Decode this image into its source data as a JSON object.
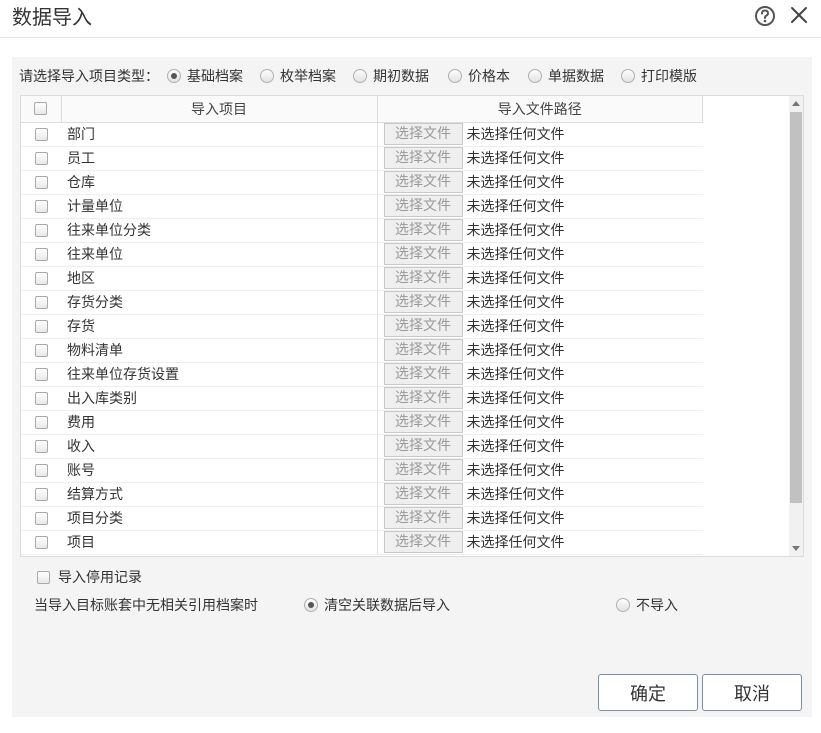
{
  "dialog": {
    "title": "数据导入"
  },
  "import_type": {
    "label": "请选择导入项目类型：",
    "options": [
      {
        "label": "基础档案",
        "checked": true
      },
      {
        "label": "枚举档案",
        "checked": false
      },
      {
        "label": "期初数据",
        "checked": false
      },
      {
        "label": "价格本",
        "checked": false
      },
      {
        "label": "单据数据",
        "checked": false
      },
      {
        "label": "打印模版",
        "checked": false
      }
    ]
  },
  "grid": {
    "headers": {
      "item": "导入项目",
      "path": "导入文件路径"
    },
    "rows": [
      {
        "name": "部门",
        "button": "选择文件",
        "status": "未选择任何文件"
      },
      {
        "name": "员工",
        "button": "选择文件",
        "status": "未选择任何文件"
      },
      {
        "name": "仓库",
        "button": "选择文件",
        "status": "未选择任何文件"
      },
      {
        "name": "计量单位",
        "button": "选择文件",
        "status": "未选择任何文件"
      },
      {
        "name": "往来单位分类",
        "button": "选择文件",
        "status": "未选择任何文件"
      },
      {
        "name": "往来单位",
        "button": "选择文件",
        "status": "未选择任何文件"
      },
      {
        "name": "地区",
        "button": "选择文件",
        "status": "未选择任何文件"
      },
      {
        "name": "存货分类",
        "button": "选择文件",
        "status": "未选择任何文件"
      },
      {
        "name": "存货",
        "button": "选择文件",
        "status": "未选择任何文件"
      },
      {
        "name": "物料清单",
        "button": "选择文件",
        "status": "未选择任何文件"
      },
      {
        "name": "往来单位存货设置",
        "button": "选择文件",
        "status": "未选择任何文件"
      },
      {
        "name": "出入库类别",
        "button": "选择文件",
        "status": "未选择任何文件"
      },
      {
        "name": "费用",
        "button": "选择文件",
        "status": "未选择任何文件"
      },
      {
        "name": "收入",
        "button": "选择文件",
        "status": "未选择任何文件"
      },
      {
        "name": "账号",
        "button": "选择文件",
        "status": "未选择任何文件"
      },
      {
        "name": "结算方式",
        "button": "选择文件",
        "status": "未选择任何文件"
      },
      {
        "name": "项目分类",
        "button": "选择文件",
        "status": "未选择任何文件"
      },
      {
        "name": "项目",
        "button": "选择文件",
        "status": "未选择任何文件"
      }
    ]
  },
  "options": {
    "import_disabled": "导入停用记录",
    "ref_label": "当导入目标账套中无相关引用档案时",
    "ref_clear": "清空关联数据后导入",
    "ref_skip": "不导入",
    "ref_clear_checked": true
  },
  "buttons": {
    "ok": "确定",
    "cancel": "取消"
  },
  "icons": {
    "help": "help-circle-icon",
    "close": "close-icon"
  }
}
